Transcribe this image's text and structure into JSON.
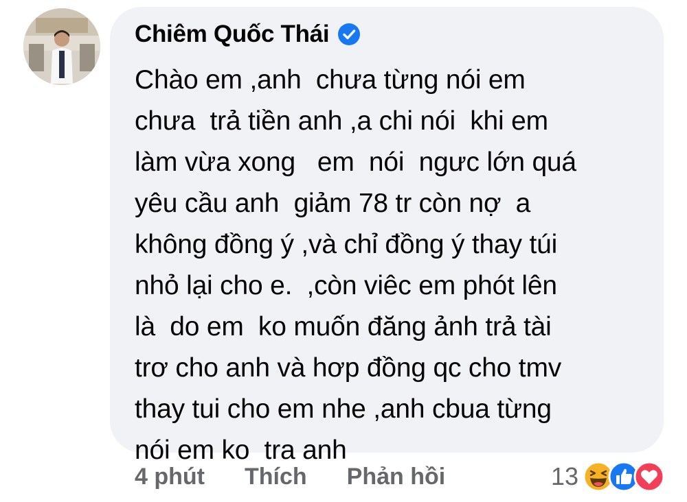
{
  "comment": {
    "author": "Chiêm Quốc Thái",
    "verified_icon": "verified-badge-icon",
    "avatar_icon": "doctor-avatar",
    "lines": [
      "Chào em ,anh  chưa từng nói em",
      "chưa  trả tiền anh ,a chi nói  khi em",
      "làm vừa xong   em  nói  ngưc lớn quá",
      "yêu cầu anh  giảm 78 tr còn nợ  a",
      "không đồng ý ,và chỉ đồng ý thay túi",
      "nhỏ lại cho e.  ,còn viêc em phót lên",
      "là  do em  ko muốn đăng ảnh trả tài",
      "trơ cho anh và hơp đồng qc cho tmv",
      "thay tui cho em nhe ,anh cbua từng",
      "nói em ko  tra anh"
    ]
  },
  "actions": {
    "time": "4 phút",
    "like": "Thích",
    "reply": "Phản hồi"
  },
  "reactions": {
    "count": "13",
    "icons": [
      "haha-icon",
      "like-icon",
      "love-icon"
    ],
    "colors": {
      "haha": "#f7b125",
      "like": "#1877f2",
      "love": "#f33e58",
      "verified": "#1877f2",
      "bubble": "#f0f2f5",
      "meta_text": "#65676b"
    }
  }
}
